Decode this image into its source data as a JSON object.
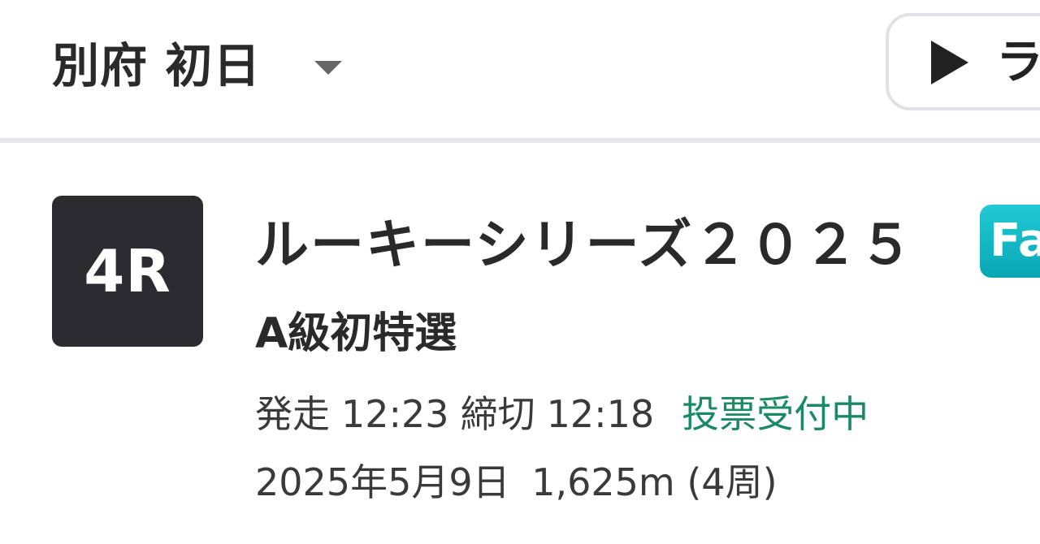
{
  "header": {
    "venue_title": "別府 初日",
    "live_button_label": "ラ",
    "icons": {
      "dropdown": "caret-down-icon",
      "play": "play-icon"
    }
  },
  "race": {
    "number_badge": "4R",
    "name": "ルーキーシリーズ２０２５",
    "grade_badge": "Fa",
    "class": "A級初特選",
    "start_label": "発走",
    "start_time": "12:23",
    "deadline_label": "締切",
    "deadline_time": "12:18",
    "status": "投票受付中",
    "date": "2025年5月9日",
    "distance": "1,625m (4周)"
  },
  "colors": {
    "badge_bg": "#2c2b30",
    "status_green": "#1a8a63",
    "fast_badge": "#12b5c3"
  }
}
